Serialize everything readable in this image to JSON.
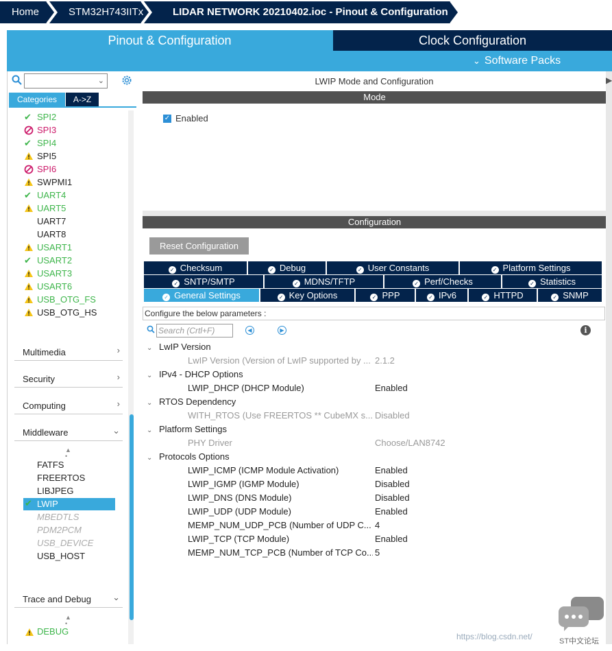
{
  "breadcrumb": [
    "Home",
    "STM32H743IITx",
    "LIDAR NETWORK 20210402.ioc - Pinout & Configuration"
  ],
  "tabs": {
    "pinout": "Pinout & Configuration",
    "clock": "Clock Configuration",
    "software_packs": "Software Packs"
  },
  "left": {
    "cat_tabs": [
      "Categories",
      "A->Z"
    ],
    "peripherals": [
      {
        "label": "SPI2",
        "status": "ok",
        "color": "green"
      },
      {
        "label": "SPI3",
        "status": "blocked",
        "color": "pink"
      },
      {
        "label": "SPI4",
        "status": "ok",
        "color": "green"
      },
      {
        "label": "SPI5",
        "status": "warn",
        "color": "dark"
      },
      {
        "label": "SPI6",
        "status": "blocked",
        "color": "pink"
      },
      {
        "label": "SWPMI1",
        "status": "warn",
        "color": "dark"
      },
      {
        "label": "UART4",
        "status": "ok",
        "color": "green"
      },
      {
        "label": "UART5",
        "status": "warn",
        "color": "green"
      },
      {
        "label": "UART7",
        "status": "none",
        "color": "dark"
      },
      {
        "label": "UART8",
        "status": "none",
        "color": "dark"
      },
      {
        "label": "USART1",
        "status": "warn",
        "color": "green"
      },
      {
        "label": "USART2",
        "status": "ok",
        "color": "green"
      },
      {
        "label": "USART3",
        "status": "warn",
        "color": "green"
      },
      {
        "label": "USART6",
        "status": "warn",
        "color": "green"
      },
      {
        "label": "USB_OTG_FS",
        "status": "warn",
        "color": "green"
      },
      {
        "label": "USB_OTG_HS",
        "status": "warn",
        "color": "dark"
      }
    ],
    "sections": {
      "multimedia": "Multimedia",
      "security": "Security",
      "computing": "Computing",
      "middleware": "Middleware",
      "trace": "Trace and Debug"
    },
    "middleware_items": {
      "fatfs": "FATFS",
      "freertos": "FREERTOS",
      "libjpeg": "LIBJPEG",
      "lwip": "LWIP",
      "mbedtls": "MBEDTLS",
      "pdm2pcm": "PDM2PCM",
      "usb_device": "USB_DEVICE",
      "usb_host": "USB_HOST"
    },
    "debug_item": "DEBUG"
  },
  "right": {
    "title": "LWIP Mode and Configuration",
    "mode_header": "Mode",
    "enabled_label": "Enabled",
    "config_header": "Configuration",
    "reset_button": "Reset Configuration",
    "tabs_row1": [
      "Checksum",
      "Debug",
      "User Constants",
      "Platform Settings"
    ],
    "tabs_row2": [
      "SNTP/SMTP",
      "MDNS/TFTP",
      "Perf/Checks",
      "Statistics"
    ],
    "tabs_row3": [
      "General Settings",
      "Key Options",
      "PPP",
      "IPv6",
      "HTTPD",
      "SNMP"
    ],
    "configure_text": "Configure the below parameters :",
    "search_placeholder": "Search (Crtl+F)",
    "groups": {
      "lwip_version": "LwIP Version",
      "ipv4_dhcp": "IPv4 - DHCP Options",
      "rtos": "RTOS Dependency",
      "platform": "Platform Settings",
      "protocols": "Protocols Options"
    },
    "params": {
      "lwip_version": {
        "name": "LwIP Version (Version of LwIP supported by ...",
        "value": "2.1.2"
      },
      "lwip_dhcp": {
        "name": "LWIP_DHCP (DHCP Module)",
        "value": "Enabled"
      },
      "with_rtos": {
        "name": "WITH_RTOS (Use FREERTOS ** CubeMX s...",
        "value": "Disabled"
      },
      "phy_driver": {
        "name": "PHY Driver",
        "value": "Choose/LAN8742"
      },
      "lwip_icmp": {
        "name": "LWIP_ICMP (ICMP Module Activation)",
        "value": "Enabled"
      },
      "lwip_igmp": {
        "name": "LWIP_IGMP (IGMP Module)",
        "value": "Disabled"
      },
      "lwip_dns": {
        "name": "LWIP_DNS (DNS Module)",
        "value": "Disabled"
      },
      "lwip_udp": {
        "name": "LWIP_UDP (UDP Module)",
        "value": "Enabled"
      },
      "memp_udp": {
        "name": "MEMP_NUM_UDP_PCB (Number of UDP C...",
        "value": "4"
      },
      "lwip_tcp": {
        "name": "LWIP_TCP (TCP Module)",
        "value": "Enabled"
      },
      "memp_tcp": {
        "name": "MEMP_NUM_TCP_PCB (Number of TCP Co...",
        "value": "5"
      }
    }
  },
  "watermark": "https://blog.csdn.net/",
  "forum_text": "ST中文论坛",
  "colors": {
    "navy": "#03234b",
    "blue": "#39a9dc",
    "green": "#3db54a",
    "pink": "#cc1a6a",
    "warn": "#f5c518"
  }
}
